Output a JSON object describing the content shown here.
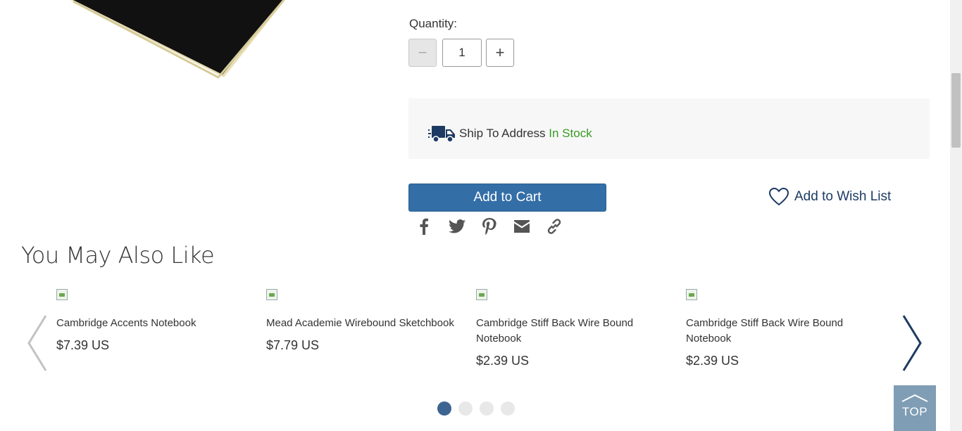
{
  "quantity": {
    "label": "Quantity:",
    "value": "1",
    "minus_symbol": "−",
    "plus_symbol": "+"
  },
  "shipping": {
    "label": "Ship To Address",
    "status": "In Stock",
    "status_color": "#3a9a24",
    "icon": "truck-icon"
  },
  "actions": {
    "add_to_cart": "Add to Cart",
    "add_to_wish_list": "Add to Wish List",
    "accent_color": "#336ea7"
  },
  "share": {
    "icons": [
      "facebook-icon",
      "twitter-icon",
      "pinterest-icon",
      "email-icon",
      "link-icon"
    ]
  },
  "recommendations": {
    "title": "You May Also Like",
    "products": [
      {
        "name": "Cambridge Accents Notebook",
        "price": "$7.39 US"
      },
      {
        "name": "Mead Academie Wirebound Sketchbook",
        "price": "$7.79 US"
      },
      {
        "name": "Cambridge Stiff Back Wire Bound Notebook",
        "price": "$2.39 US"
      },
      {
        "name": "Cambridge Stiff Back Wire Bound Notebook",
        "price": "$2.39 US"
      }
    ],
    "page_count": 4,
    "active_page": 1
  },
  "back_to_top": {
    "label": "TOP"
  }
}
